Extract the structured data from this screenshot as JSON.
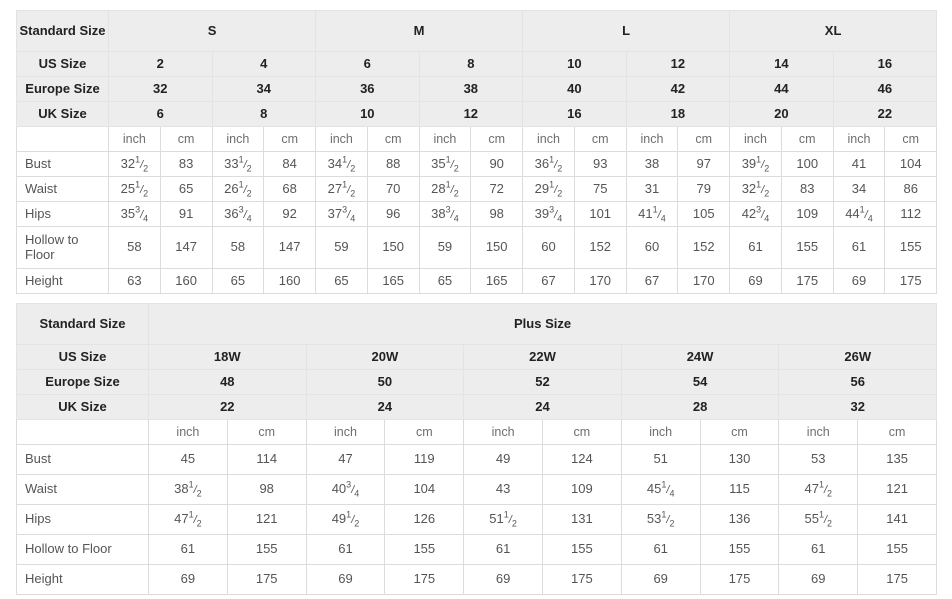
{
  "tables": [
    {
      "name": "standard-size-table",
      "row_labels": {
        "standard_size": "Standard Size",
        "us_size": "US Size",
        "europe_size": "Europe Size",
        "uk_size": "UK Size"
      },
      "groups": [
        "S",
        "M",
        "L",
        "XL"
      ],
      "us_sizes": [
        "2",
        "4",
        "6",
        "8",
        "10",
        "12",
        "14",
        "16"
      ],
      "europe_sizes": [
        "32",
        "34",
        "36",
        "38",
        "40",
        "42",
        "44",
        "46"
      ],
      "uk_sizes": [
        "6",
        "8",
        "10",
        "12",
        "16",
        "18",
        "20",
        "22"
      ],
      "units": [
        "inch",
        "cm",
        "inch",
        "cm",
        "inch",
        "cm",
        "inch",
        "cm",
        "inch",
        "cm",
        "inch",
        "cm",
        "inch",
        "cm",
        "inch",
        "cm"
      ],
      "measurements": [
        {
          "label": "Bust",
          "values": [
            {
              "w": "32",
              "n": "1",
              "d": "2"
            },
            {
              "w": "83"
            },
            {
              "w": "33",
              "n": "1",
              "d": "2"
            },
            {
              "w": "84"
            },
            {
              "w": "34",
              "n": "1",
              "d": "2"
            },
            {
              "w": "88"
            },
            {
              "w": "35",
              "n": "1",
              "d": "2"
            },
            {
              "w": "90"
            },
            {
              "w": "36",
              "n": "1",
              "d": "2"
            },
            {
              "w": "93"
            },
            {
              "w": "38"
            },
            {
              "w": "97"
            },
            {
              "w": "39",
              "n": "1",
              "d": "2"
            },
            {
              "w": "100"
            },
            {
              "w": "41"
            },
            {
              "w": "104"
            }
          ]
        },
        {
          "label": "Waist",
          "values": [
            {
              "w": "25",
              "n": "1",
              "d": "2"
            },
            {
              "w": "65"
            },
            {
              "w": "26",
              "n": "1",
              "d": "2"
            },
            {
              "w": "68"
            },
            {
              "w": "27",
              "n": "1",
              "d": "2"
            },
            {
              "w": "70"
            },
            {
              "w": "28",
              "n": "1",
              "d": "2"
            },
            {
              "w": "72"
            },
            {
              "w": "29",
              "n": "1",
              "d": "2"
            },
            {
              "w": "75"
            },
            {
              "w": "31"
            },
            {
              "w": "79"
            },
            {
              "w": "32",
              "n": "1",
              "d": "2"
            },
            {
              "w": "83"
            },
            {
              "w": "34"
            },
            {
              "w": "86"
            }
          ]
        },
        {
          "label": "Hips",
          "values": [
            {
              "w": "35",
              "n": "3",
              "d": "4"
            },
            {
              "w": "91"
            },
            {
              "w": "36",
              "n": "3",
              "d": "4"
            },
            {
              "w": "92"
            },
            {
              "w": "37",
              "n": "3",
              "d": "4"
            },
            {
              "w": "96"
            },
            {
              "w": "38",
              "n": "3",
              "d": "4"
            },
            {
              "w": "98"
            },
            {
              "w": "39",
              "n": "3",
              "d": "4"
            },
            {
              "w": "101"
            },
            {
              "w": "41",
              "n": "1",
              "d": "4"
            },
            {
              "w": "105"
            },
            {
              "w": "42",
              "n": "3",
              "d": "4"
            },
            {
              "w": "109"
            },
            {
              "w": "44",
              "n": "1",
              "d": "4"
            },
            {
              "w": "112"
            }
          ]
        },
        {
          "label": "Hollow to Floor",
          "values": [
            {
              "w": "58"
            },
            {
              "w": "147"
            },
            {
              "w": "58"
            },
            {
              "w": "147"
            },
            {
              "w": "59"
            },
            {
              "w": "150"
            },
            {
              "w": "59"
            },
            {
              "w": "150"
            },
            {
              "w": "60"
            },
            {
              "w": "152"
            },
            {
              "w": "60"
            },
            {
              "w": "152"
            },
            {
              "w": "61"
            },
            {
              "w": "155"
            },
            {
              "w": "61"
            },
            {
              "w": "155"
            }
          ]
        },
        {
          "label": "Height",
          "values": [
            {
              "w": "63"
            },
            {
              "w": "160"
            },
            {
              "w": "65"
            },
            {
              "w": "160"
            },
            {
              "w": "65"
            },
            {
              "w": "165"
            },
            {
              "w": "65"
            },
            {
              "w": "165"
            },
            {
              "w": "67"
            },
            {
              "w": "170"
            },
            {
              "w": "67"
            },
            {
              "w": "170"
            },
            {
              "w": "69"
            },
            {
              "w": "175"
            },
            {
              "w": "69"
            },
            {
              "w": "175"
            }
          ]
        }
      ]
    },
    {
      "name": "plus-size-table",
      "row_labels": {
        "standard_size": "Standard Size",
        "us_size": "US Size",
        "europe_size": "Europe Size",
        "uk_size": "UK Size"
      },
      "group_title": "Plus Size",
      "us_sizes": [
        "18W",
        "20W",
        "22W",
        "24W",
        "26W"
      ],
      "europe_sizes": [
        "48",
        "50",
        "52",
        "54",
        "56"
      ],
      "uk_sizes": [
        "22",
        "24",
        "24",
        "28",
        "32"
      ],
      "units": [
        "inch",
        "cm",
        "inch",
        "cm",
        "inch",
        "cm",
        "inch",
        "cm",
        "inch",
        "cm"
      ],
      "measurements": [
        {
          "label": "Bust",
          "values": [
            {
              "w": "45"
            },
            {
              "w": "114"
            },
            {
              "w": "47"
            },
            {
              "w": "119"
            },
            {
              "w": "49"
            },
            {
              "w": "124"
            },
            {
              "w": "51"
            },
            {
              "w": "130"
            },
            {
              "w": "53"
            },
            {
              "w": "135"
            }
          ]
        },
        {
          "label": "Waist",
          "values": [
            {
              "w": "38",
              "n": "1",
              "d": "2"
            },
            {
              "w": "98"
            },
            {
              "w": "40",
              "n": "3",
              "d": "4"
            },
            {
              "w": "104"
            },
            {
              "w": "43"
            },
            {
              "w": "109"
            },
            {
              "w": "45",
              "n": "1",
              "d": "4"
            },
            {
              "w": "115"
            },
            {
              "w": "47",
              "n": "1",
              "d": "2"
            },
            {
              "w": "121"
            }
          ]
        },
        {
          "label": "Hips",
          "values": [
            {
              "w": "47",
              "n": "1",
              "d": "2"
            },
            {
              "w": "121"
            },
            {
              "w": "49",
              "n": "1",
              "d": "2"
            },
            {
              "w": "126"
            },
            {
              "w": "51",
              "n": "1",
              "d": "2"
            },
            {
              "w": "131"
            },
            {
              "w": "53",
              "n": "1",
              "d": "2"
            },
            {
              "w": "136"
            },
            {
              "w": "55",
              "n": "1",
              "d": "2"
            },
            {
              "w": "141"
            }
          ]
        },
        {
          "label": "Hollow to Floor",
          "values": [
            {
              "w": "61"
            },
            {
              "w": "155"
            },
            {
              "w": "61"
            },
            {
              "w": "155"
            },
            {
              "w": "61"
            },
            {
              "w": "155"
            },
            {
              "w": "61"
            },
            {
              "w": "155"
            },
            {
              "w": "61"
            },
            {
              "w": "155"
            }
          ]
        },
        {
          "label": "Height",
          "values": [
            {
              "w": "69"
            },
            {
              "w": "175"
            },
            {
              "w": "69"
            },
            {
              "w": "175"
            },
            {
              "w": "69"
            },
            {
              "w": "175"
            },
            {
              "w": "69"
            },
            {
              "w": "175"
            },
            {
              "w": "69"
            },
            {
              "w": "175"
            }
          ]
        }
      ]
    }
  ],
  "colors": {
    "header_bg": "#ededed",
    "border": "#dcdcdc",
    "text": "#555555",
    "header_text": "#222222"
  }
}
